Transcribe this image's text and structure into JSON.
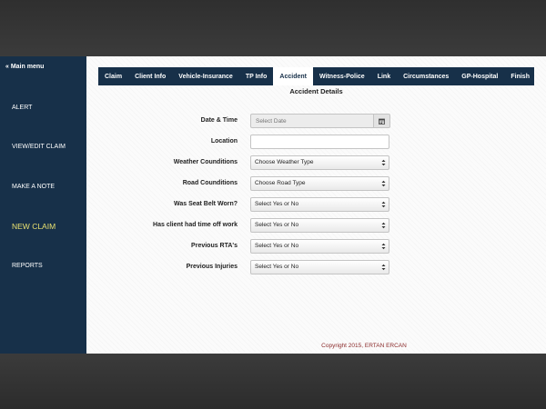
{
  "sidebar": {
    "main_menu": "« Main menu",
    "items": [
      {
        "label": "ALERT"
      },
      {
        "label": "VIEW/EDIT CLAIM"
      },
      {
        "label": "MAKE A NOTE"
      },
      {
        "label": "NEW CLAIM"
      },
      {
        "label": "REPORTS"
      }
    ],
    "active_item": "NEW CLAIM"
  },
  "tabs": [
    {
      "label": "Claim"
    },
    {
      "label": "Client Info"
    },
    {
      "label": "Vehicle-Insurance"
    },
    {
      "label": "TP Info"
    },
    {
      "label": "Accident"
    },
    {
      "label": "Witness-Police"
    },
    {
      "label": "Link"
    },
    {
      "label": "Circumstances"
    },
    {
      "label": "GP-Hospital"
    },
    {
      "label": "Finish"
    }
  ],
  "active_tab": "Accident",
  "section_title": "Accident Details",
  "form": {
    "date_time": {
      "label": "Date & Time",
      "placeholder": "Select Date",
      "value": ""
    },
    "location": {
      "label": "Location",
      "value": ""
    },
    "weather": {
      "label": "Weather Counditions",
      "selected": "Choose Weather Type"
    },
    "road": {
      "label": "Road Counditions",
      "selected": "Choose Road Type"
    },
    "seat_belt": {
      "label": "Was Seat Belt Worn?",
      "selected": "Select Yes or No"
    },
    "time_off": {
      "label": "Has client had time off work",
      "selected": "Select Yes or No"
    },
    "previous_rta": {
      "label": "Previous RTA's",
      "selected": "Select Yes or No"
    },
    "previous_injuries": {
      "label": "Previous Injuries",
      "selected": "Select Yes or No"
    }
  },
  "footer": {
    "copyright": "Copyright 2015, ERTAN ERCAN"
  },
  "icons": {
    "date_button": "calendar-icon",
    "select_arrow": "updown-arrows-icon"
  },
  "colors": {
    "primary": "#173049",
    "active_nav": "#e8e070",
    "footer_text": "#8a2a2a"
  }
}
